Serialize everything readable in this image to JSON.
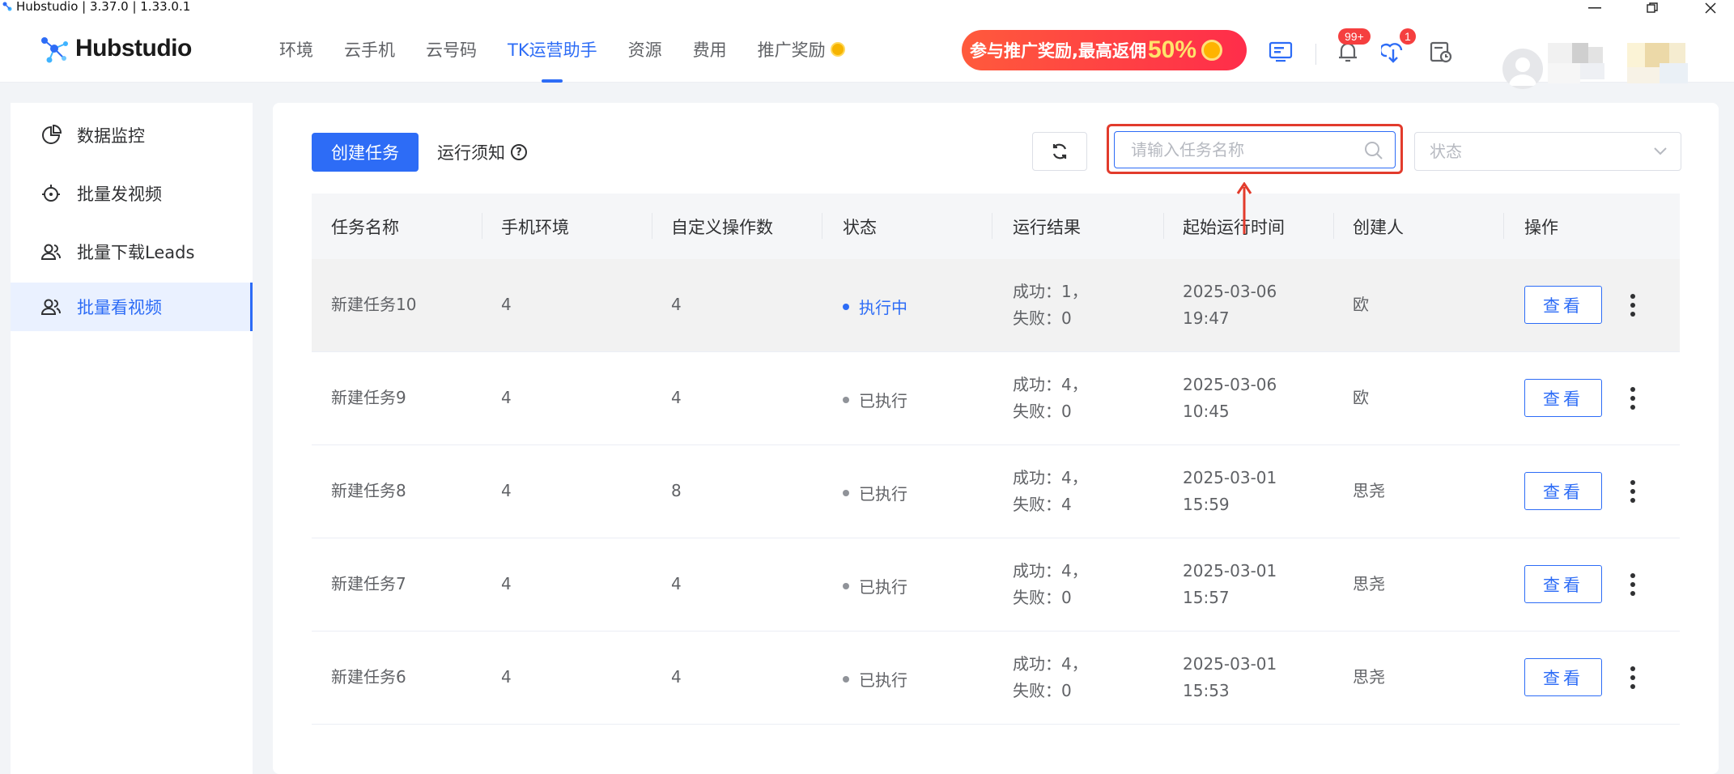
{
  "window": {
    "title": "Hubstudio | 3.37.0 | 1.33.0.1"
  },
  "header": {
    "logo_text": "Hubstudio",
    "nav": [
      {
        "label": "环境",
        "active": false
      },
      {
        "label": "云手机",
        "active": false
      },
      {
        "label": "云号码",
        "active": false
      },
      {
        "label": "TK运营助手",
        "active": true
      },
      {
        "label": "资源",
        "active": false
      },
      {
        "label": "费用",
        "active": false
      },
      {
        "label": "推广奖励",
        "active": false
      }
    ],
    "promo_text": "参与推广奖励,最高返佣",
    "promo_percent": "50%",
    "notification_badge": "99+",
    "download_badge": "1"
  },
  "sidebar": {
    "items": [
      {
        "label": "数据监控",
        "icon": "chart-pie-icon",
        "active": false
      },
      {
        "label": "批量发视频",
        "icon": "robot-icon",
        "active": false
      },
      {
        "label": "批量下载Leads",
        "icon": "users-icon",
        "active": false
      },
      {
        "label": "批量看视频",
        "icon": "users-icon",
        "active": true
      }
    ]
  },
  "toolbar": {
    "create_label": "创建任务",
    "notice_label": "运行须知",
    "search_placeholder": "请输入任务名称",
    "status_placeholder": "状态"
  },
  "table": {
    "columns": [
      "任务名称",
      "手机环境",
      "自定义操作数",
      "状态",
      "运行结果",
      "起始运行时间",
      "创建人",
      "操作"
    ],
    "rows": [
      {
        "name": "新建任务10",
        "env": "4",
        "ops": "4",
        "status": "执行中",
        "status_color": "#2d6cf6",
        "result_success": "成功：1，",
        "result_fail": "失败：0",
        "date": "2025-03-06",
        "time": "19:47",
        "creator": "欧",
        "action": "查看"
      },
      {
        "name": "新建任务9",
        "env": "4",
        "ops": "4",
        "status": "已执行",
        "status_color": "#909399",
        "result_success": "成功：4，",
        "result_fail": "失败：0",
        "date": "2025-03-06",
        "time": "10:45",
        "creator": "欧",
        "action": "查看"
      },
      {
        "name": "新建任务8",
        "env": "4",
        "ops": "8",
        "status": "已执行",
        "status_color": "#909399",
        "result_success": "成功：4，",
        "result_fail": "失败：4",
        "date": "2025-03-01",
        "time": "15:59",
        "creator": "思尧",
        "action": "查看"
      },
      {
        "name": "新建任务7",
        "env": "4",
        "ops": "4",
        "status": "已执行",
        "status_color": "#909399",
        "result_success": "成功：4，",
        "result_fail": "失败：0",
        "date": "2025-03-01",
        "time": "15:57",
        "creator": "思尧",
        "action": "查看"
      },
      {
        "name": "新建任务6",
        "env": "4",
        "ops": "4",
        "status": "已执行",
        "status_color": "#909399",
        "result_success": "成功：4，",
        "result_fail": "失败：0",
        "date": "2025-03-01",
        "time": "15:53",
        "creator": "思尧",
        "action": "查看"
      }
    ]
  },
  "colors": {
    "accent": "#2d6cf6",
    "annotation": "#e23b2c"
  }
}
